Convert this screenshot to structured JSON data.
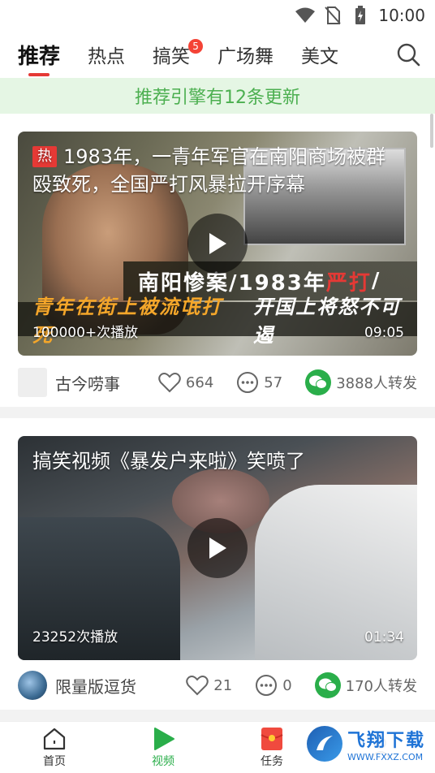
{
  "status_bar": {
    "time": "10:00",
    "icons": [
      "wifi-icon",
      "no-sim-icon",
      "battery-charging-icon"
    ]
  },
  "tabs": [
    {
      "label": "推荐",
      "active": true
    },
    {
      "label": "热点"
    },
    {
      "label": "搞笑",
      "badge": "5"
    },
    {
      "label": "广场舞"
    },
    {
      "label": "美文"
    }
  ],
  "search_icon": "search-icon",
  "notice": "推荐引擎有12条更新",
  "videos": [
    {
      "hot_label": "热",
      "title": "1983年，一青年军官在南阳商场被群殴致死，全国严打风暴拉开序幕",
      "overlay_line1_a": "南阳惨案",
      "overlay_line1_b": "/1983年",
      "overlay_line1_c": "严打",
      "overlay_line1_d": "/",
      "overlay_line2_a": "青年在街上被流氓打死",
      "overlay_line2_b": "开国上将怒不可遏",
      "plays": "100000+次播放",
      "duration": "09:05",
      "author": "古今唠事",
      "likes": "664",
      "comments": "57",
      "shares": "3888人转发"
    },
    {
      "title": "搞笑视频《暴发户来啦》笑喷了",
      "plays": "23252次播放",
      "duration": "01:34",
      "author": "限量版逗货",
      "likes": "21",
      "comments": "0",
      "shares": "170人转发"
    }
  ],
  "bottom_nav": [
    {
      "label": "首页",
      "icon": "home-icon"
    },
    {
      "label": "视频",
      "icon": "play-icon",
      "active": true
    },
    {
      "label": "任务",
      "icon": "red-envelope-icon"
    },
    {
      "label": "",
      "icon": "profile-icon"
    }
  ],
  "watermark": {
    "big": "飞翔下载",
    "small": "WWW.FXXZ.COM"
  },
  "colors": {
    "accent_red": "#e53935",
    "brand_green": "#2aae4a",
    "notice_bg": "#e5f6e4"
  }
}
